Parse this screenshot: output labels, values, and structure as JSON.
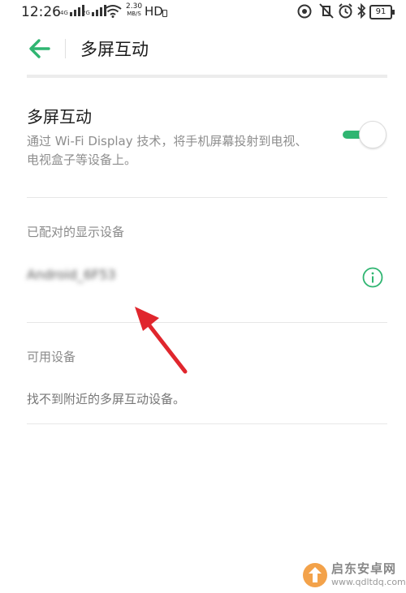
{
  "status_bar": {
    "time": "12:26",
    "net1": "4G",
    "net2": "2G",
    "speed_value": "2.30",
    "speed_unit": "MB/S",
    "hd": "HD",
    "battery": "91"
  },
  "header": {
    "title": "多屏互动",
    "back_icon": "back-arrow-icon"
  },
  "toggle_section": {
    "title": "多屏互动",
    "description": "通过 Wi-Fi Display 技术，将手机屏幕投射到电视、电视盒子等设备上。",
    "enabled": true
  },
  "paired_devices": {
    "label": "已配对的显示设备",
    "items": [
      {
        "name": "Android_6F53"
      }
    ]
  },
  "available_devices": {
    "label": "可用设备",
    "empty_message": "找不到附近的多屏互动设备。"
  },
  "watermark": {
    "name": "启东安卓网",
    "url": "www.qdltdq.com"
  },
  "colors": {
    "accent": "#2fb571",
    "annotation_arrow": "#e0262d"
  }
}
